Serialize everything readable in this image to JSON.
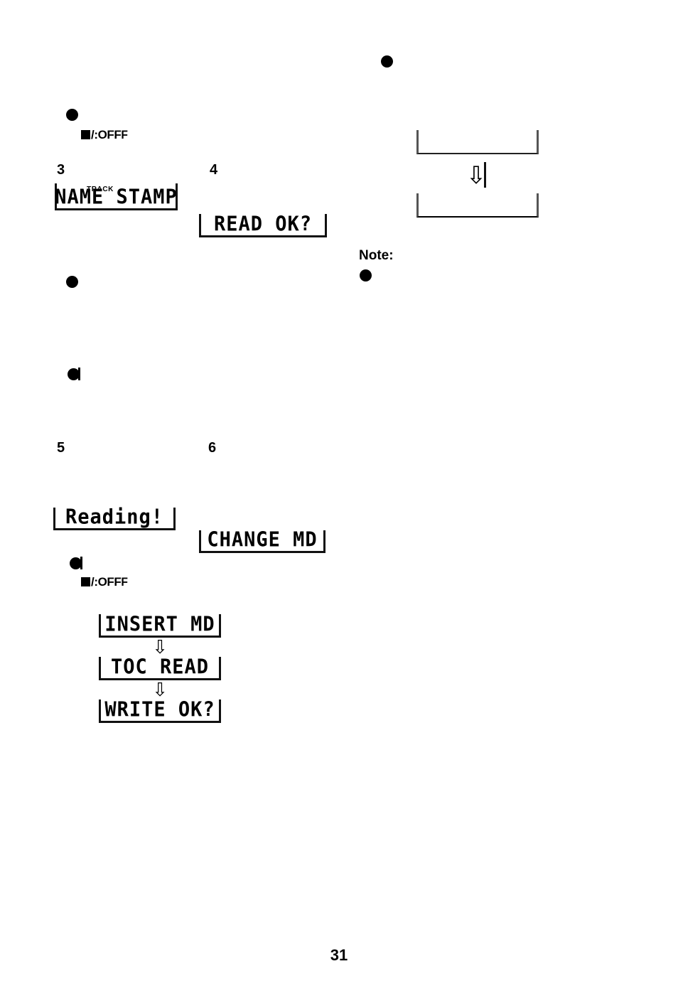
{
  "page": {
    "number": "31"
  },
  "markers": {
    "off_square": "■",
    "off_label": "/:OFF",
    "off_label_tail": "F"
  },
  "bullets": {
    "top_right": "●",
    "upper_left": "●",
    "mid_left": "●",
    "mid_left_tick": "●",
    "note": "●",
    "lower_left_tick": "●"
  },
  "steps": [
    {
      "number": "3",
      "display": "NAME STAMP",
      "indicator": "TRACK"
    },
    {
      "number": "4",
      "display": "READ OK?",
      "indicator": ""
    },
    {
      "number": "5",
      "display": "Reading!",
      "indicator": ""
    },
    {
      "number": "6",
      "display": "CHANGE MD",
      "indicator": ""
    }
  ],
  "top_right_diagram": {
    "box_top_text": "",
    "arrow": "⇩",
    "box_bottom_text": ""
  },
  "note": {
    "heading": "Note:"
  },
  "bottom_flow": {
    "arrow": "⇩",
    "steps": [
      {
        "display": "INSERT MD"
      },
      {
        "display": "TOC READ"
      },
      {
        "display": "WRITE OK?"
      }
    ]
  }
}
